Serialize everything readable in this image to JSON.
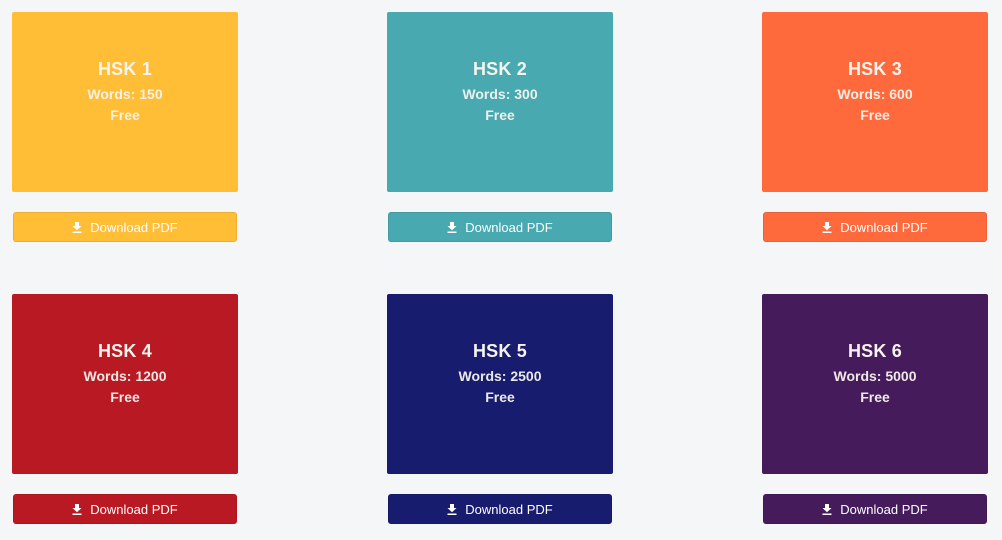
{
  "levels": [
    {
      "title": "HSK 1",
      "words": "Words: 150",
      "price": "Free",
      "button": "Download PDF",
      "icon": "download-icon",
      "color": "#ffbe36"
    },
    {
      "title": "HSK 2",
      "words": "Words: 300",
      "price": "Free",
      "button": "Download PDF",
      "icon": "download-icon",
      "color": "#48a9b1"
    },
    {
      "title": "HSK 3",
      "words": "Words: 600",
      "price": "Free",
      "button": "Download PDF",
      "icon": "download-icon",
      "color": "#ff6a3c"
    },
    {
      "title": "HSK 4",
      "words": "Words: 1200",
      "price": "Free",
      "button": "Download PDF",
      "icon": "download-icon",
      "color": "#b91922"
    },
    {
      "title": "HSK 5",
      "words": "Words: 2500",
      "price": "Free",
      "button": "Download PDF",
      "icon": "download-icon",
      "color": "#181c6e"
    },
    {
      "title": "HSK 6",
      "words": "Words: 5000",
      "price": "Free",
      "button": "Download PDF",
      "icon": "download-icon",
      "color": "#461b5c"
    }
  ]
}
